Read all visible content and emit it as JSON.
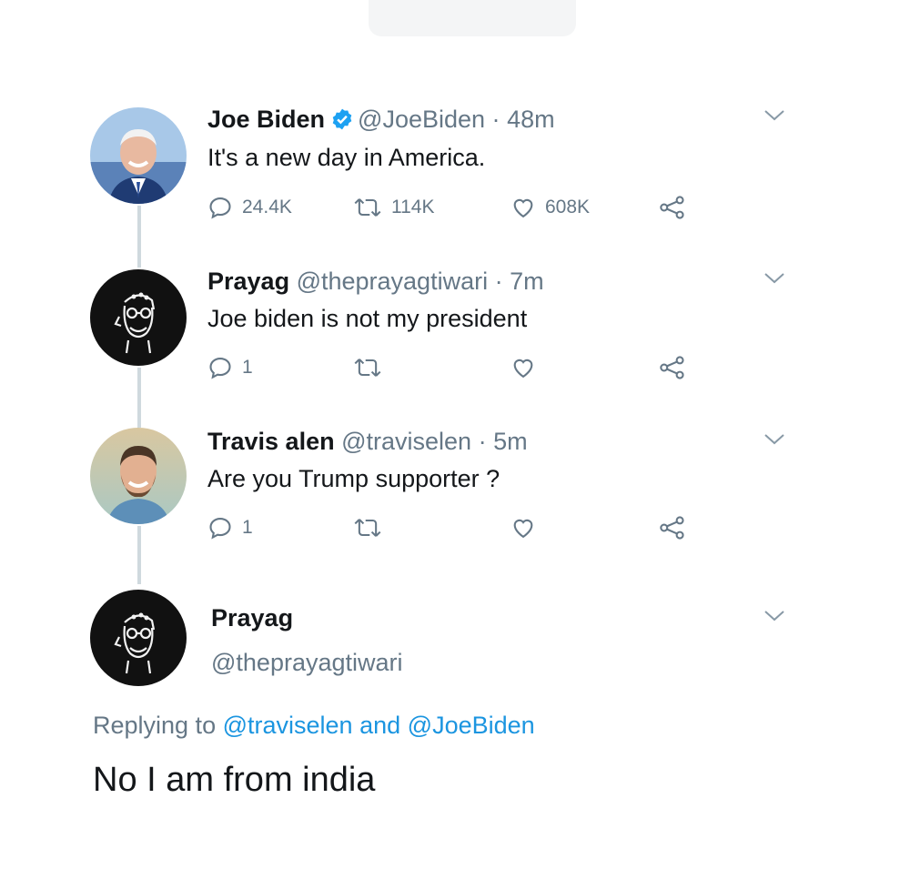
{
  "tweets": [
    {
      "name": "Joe Biden",
      "verified": true,
      "handle": "@JoeBiden",
      "separator": "·",
      "time": "48m",
      "text": "It's a new day in America.",
      "replies": "24.4K",
      "retweets": "114K",
      "likes": "608K"
    },
    {
      "name": "Prayag",
      "handle": "@theprayagtiwari",
      "separator": "·",
      "time": "7m",
      "text": "Joe biden is not my president",
      "replies": "1"
    },
    {
      "name": "Travis alen",
      "handle": "@traviselen",
      "separator": "·",
      "time": "5m",
      "text": "Are you Trump supporter ?",
      "replies": "1"
    }
  ],
  "focused_reply": {
    "name": "Prayag",
    "handle": "@theprayagtiwari",
    "replying_to_prefix": "Replying to",
    "mention_1": "@traviselen",
    "conjunction": "and",
    "mention_2": "@JoeBiden",
    "text": "No I am from india"
  },
  "icons": {
    "verified": "verified-badge-icon",
    "reply": "reply-bubble-icon",
    "retweet": "retweet-icon",
    "like": "heart-icon",
    "share": "share-icon",
    "more": "chevron-down-icon"
  },
  "colors": {
    "text": "#14171a",
    "secondary": "#657786",
    "link": "#1b95e0",
    "verified": "#1da1f2",
    "thread_line": "#cfd9de"
  }
}
